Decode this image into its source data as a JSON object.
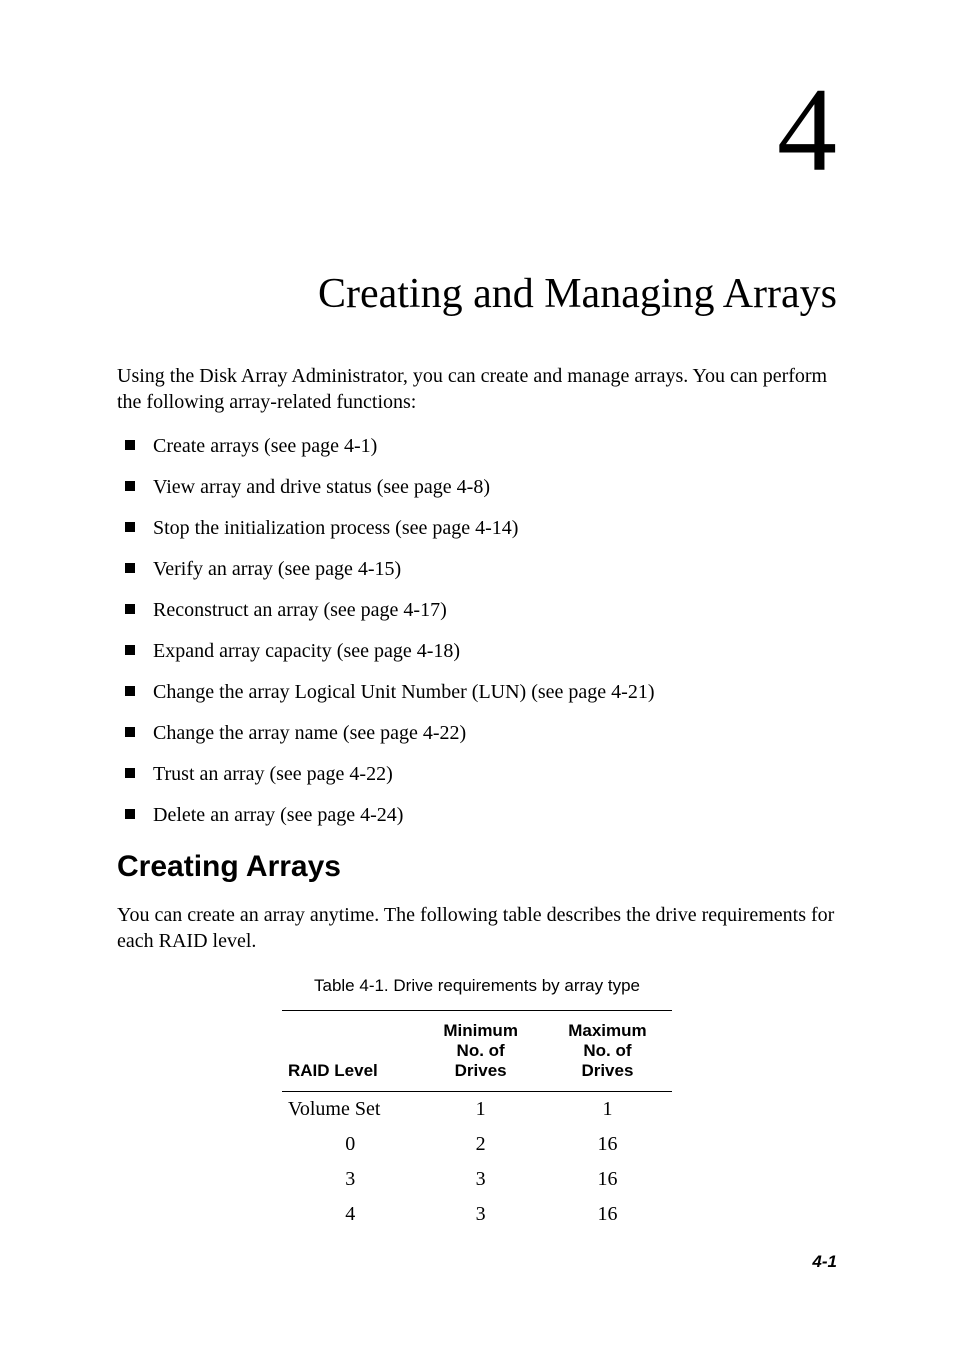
{
  "chapter_number": "4",
  "chapter_title": "Creating and Managing Arrays",
  "intro_paragraph": "Using the Disk Array Administrator, you can create and manage arrays. You can perform the following array-related functions:",
  "bullet_items": [
    "Create arrays (see page 4-1)",
    "View array and drive status (see page 4-8)",
    "Stop the initialization process (see page 4-14)",
    "Verify an array (see page 4-15)",
    "Reconstruct an array (see page 4-17)",
    "Expand array capacity (see page 4-18)",
    "Change the array Logical Unit Number (LUN) (see page 4-21)",
    "Change the array name (see page 4-22)",
    "Trust an array (see page 4-22)",
    "Delete an array (see page 4-24)"
  ],
  "section_heading": "Creating Arrays",
  "section_paragraph": "You can create an array anytime. The following table describes the drive requirements for each RAID level.",
  "table_caption": "Table 4-1. Drive requirements by array type",
  "table_headers": {
    "col0": "RAID Level",
    "col1_line1": "Minimum",
    "col1_line2": "No. of",
    "col1_line3": "Drives",
    "col2_line1": "Maximum",
    "col2_line2": "No. of",
    "col2_line3": "Drives"
  },
  "table_rows": [
    {
      "raid": "Volume Set",
      "min": "1",
      "max": "1"
    },
    {
      "raid": "0",
      "min": "2",
      "max": "16"
    },
    {
      "raid": "3",
      "min": "3",
      "max": "16"
    },
    {
      "raid": "4",
      "min": "3",
      "max": "16"
    }
  ],
  "page_number": "4-1",
  "chart_data": {
    "type": "table",
    "title": "Table 4-1. Drive requirements by array type",
    "columns": [
      "RAID Level",
      "Minimum No. of Drives",
      "Maximum No. of Drives"
    ],
    "rows": [
      [
        "Volume Set",
        1,
        1
      ],
      [
        "0",
        2,
        16
      ],
      [
        "3",
        3,
        16
      ],
      [
        "4",
        3,
        16
      ]
    ]
  }
}
